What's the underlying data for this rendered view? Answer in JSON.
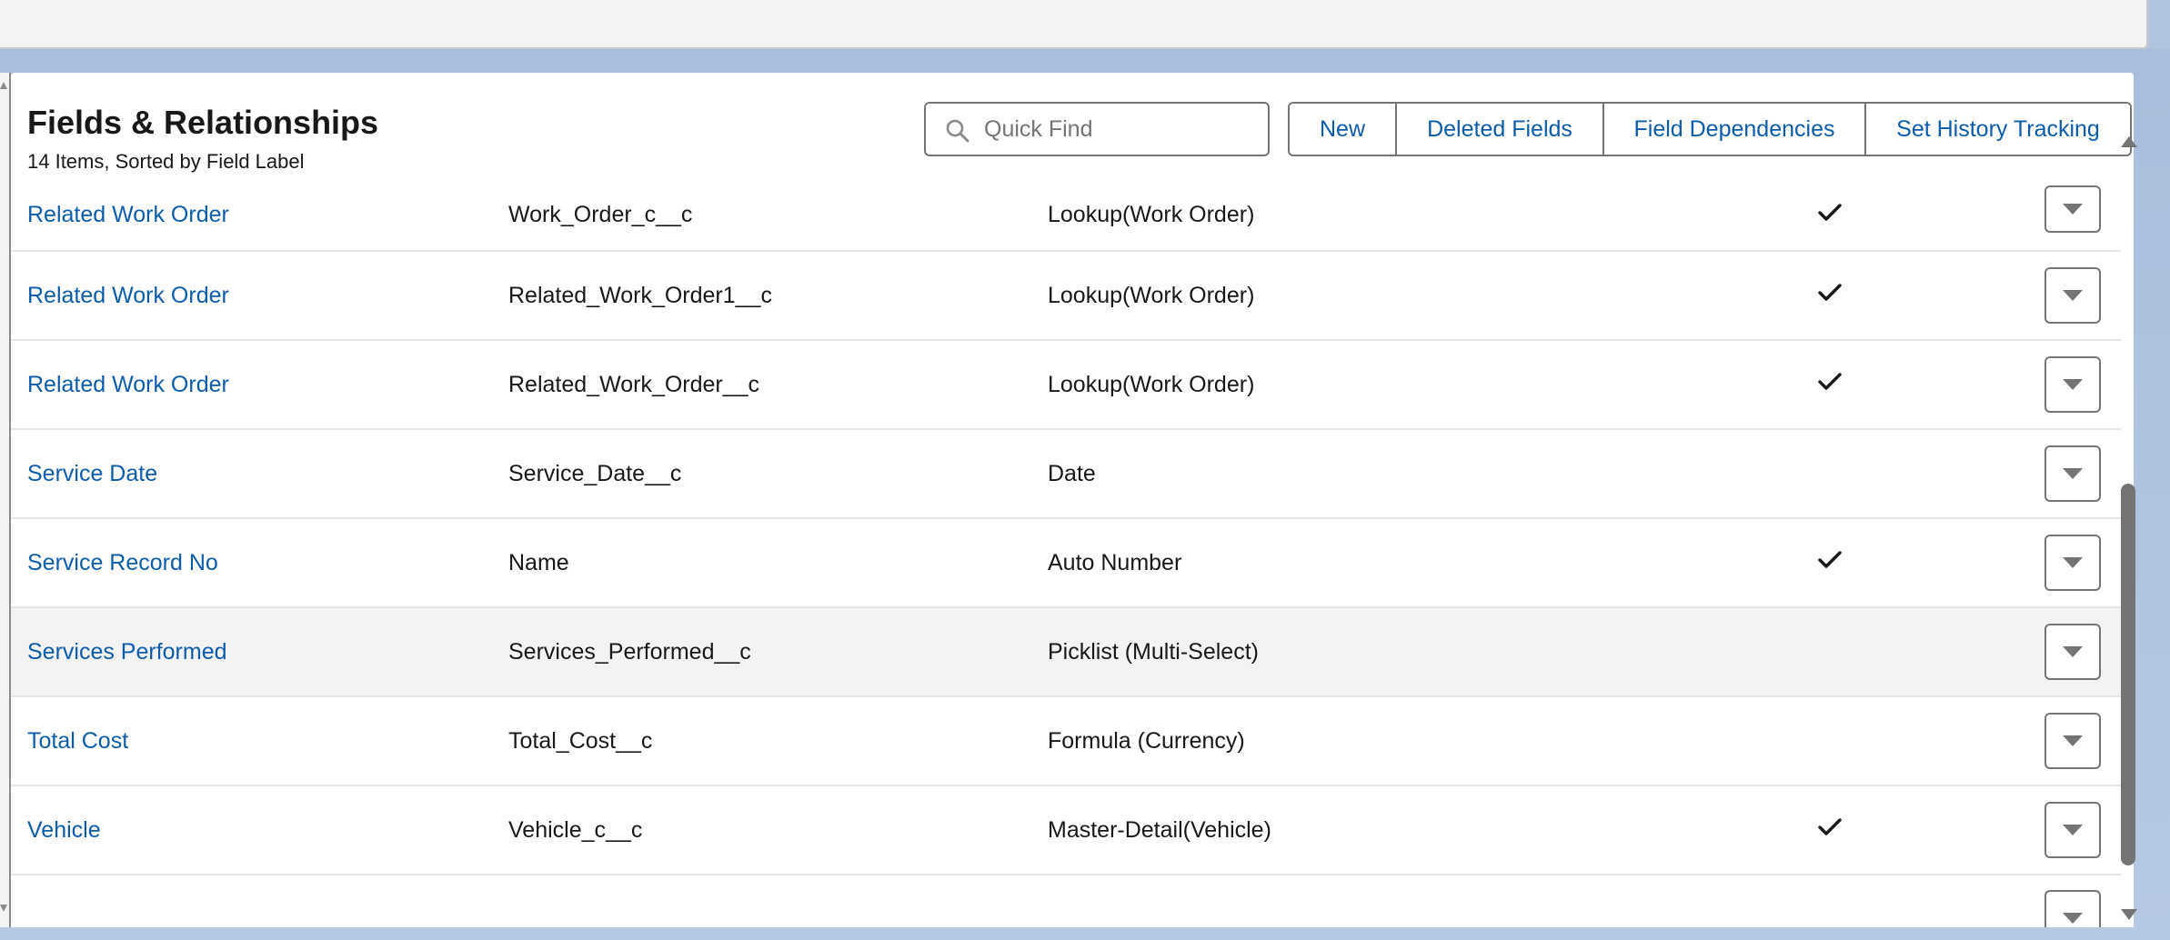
{
  "page": {
    "title": "Fields & Relationships",
    "subtitle": "14 Items, Sorted by Field Label"
  },
  "search": {
    "placeholder": "Quick Find",
    "value": ""
  },
  "actions": {
    "new": "New",
    "deleted_fields": "Deleted Fields",
    "field_dependencies": "Field Dependencies",
    "set_history_tracking": "Set History Tracking"
  },
  "icons": {
    "search": "search-icon",
    "check": "check-icon",
    "row_menu": "chevron-down-icon",
    "scroll_up": "scroll-up-icon",
    "scroll_down": "scroll-down-icon"
  },
  "colors": {
    "link": "#0b5cab",
    "text": "#181818",
    "border": "#747474",
    "highlight_row": "#f3f3f3"
  },
  "rows": [
    {
      "label": "Related Work Order",
      "api_name": "Work_Order_c__c",
      "type": "Lookup(Work Order)",
      "indexed": true
    },
    {
      "label": "Related Work Order",
      "api_name": "Related_Work_Order1__c",
      "type": "Lookup(Work Order)",
      "indexed": true
    },
    {
      "label": "Related Work Order",
      "api_name": "Related_Work_Order__c",
      "type": "Lookup(Work Order)",
      "indexed": true
    },
    {
      "label": "Service Date",
      "api_name": "Service_Date__c",
      "type": "Date",
      "indexed": false
    },
    {
      "label": "Service Record No",
      "api_name": "Name",
      "type": "Auto Number",
      "indexed": true
    },
    {
      "label": "Services Performed",
      "api_name": "Services_Performed__c",
      "type": "Picklist (Multi-Select)",
      "indexed": false
    },
    {
      "label": "Total Cost",
      "api_name": "Total_Cost__c",
      "type": "Formula (Currency)",
      "indexed": false
    },
    {
      "label": "Vehicle",
      "api_name": "Vehicle_c__c",
      "type": "Master-Detail(Vehicle)",
      "indexed": true
    }
  ]
}
